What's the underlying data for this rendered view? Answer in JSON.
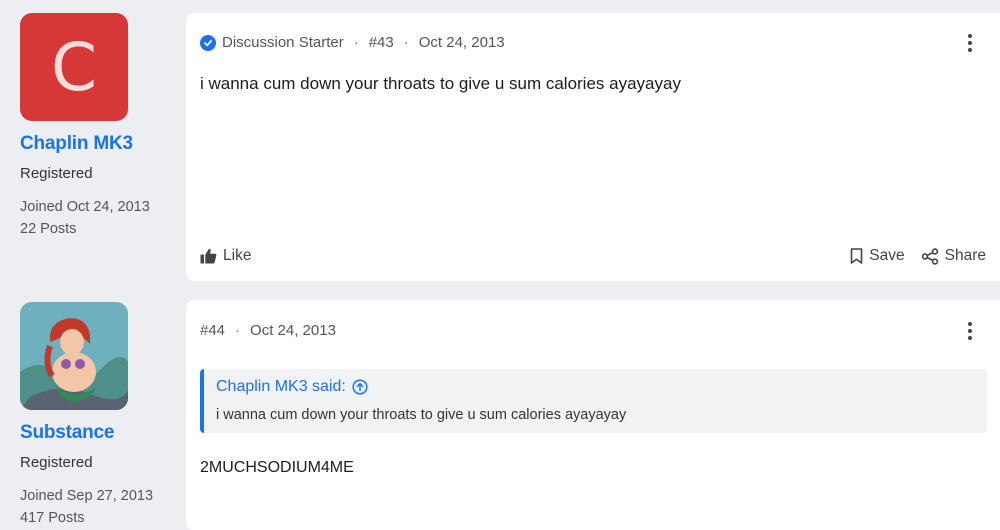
{
  "posts": [
    {
      "author": {
        "avatar_letter": "C",
        "name": "Chaplin MK3",
        "role": "Registered",
        "joined": "Joined Oct 24, 2013",
        "posts": "22 Posts"
      },
      "badge": "Discussion Starter",
      "number": "#43",
      "date": "Oct 24, 2013",
      "body": "i wanna cum down your throats to give u sum calories ayayayay",
      "actions": {
        "like": "Like",
        "save": "Save",
        "share": "Share"
      }
    },
    {
      "author": {
        "name": "Substance",
        "role": "Registered",
        "joined": "Joined Sep 27, 2013",
        "posts": "417 Posts"
      },
      "number": "#44",
      "date": "Oct 24, 2013",
      "quote": {
        "author": "Chaplin MK3 said:",
        "text": "i wanna cum down your throats to give u sum calories ayayayay"
      },
      "body": "2MUCHSODIUM4ME"
    }
  ],
  "colors": {
    "accent": "#1a73e8",
    "avatar_bg": "#d63838",
    "page_bg": "#eceef1"
  }
}
